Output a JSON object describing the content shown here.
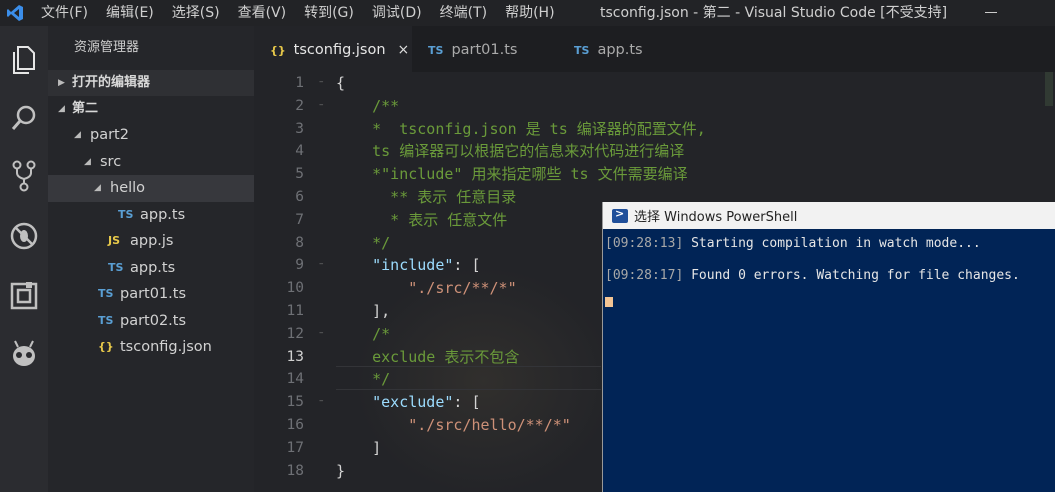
{
  "window": {
    "title": "tsconfig.json - 第二 - Visual Studio Code [不受支持]",
    "menu": [
      "文件(F)",
      "编辑(E)",
      "选择(S)",
      "查看(V)",
      "转到(G)",
      "调试(D)",
      "终端(T)",
      "帮助(H)"
    ]
  },
  "activity_bar": [
    "explorer-icon",
    "search-icon",
    "source-control-icon",
    "debug-icon",
    "extensions-icon",
    "alien-icon"
  ],
  "sidebar": {
    "header": "资源管理器",
    "open_editors": "打开的编辑器",
    "workspace": "第二",
    "tree": [
      {
        "label": "part2",
        "type": "folder",
        "depth": 1
      },
      {
        "label": "src",
        "type": "folder",
        "depth": 2
      },
      {
        "label": "hello",
        "type": "folder",
        "depth": 3,
        "selected": true
      },
      {
        "label": "app.ts",
        "type": "ts",
        "icon": "TS",
        "depth": 4
      },
      {
        "label": "app.js",
        "type": "js",
        "icon": "JS",
        "depth": 3
      },
      {
        "label": "app.ts",
        "type": "ts",
        "icon": "TS",
        "depth": 3
      },
      {
        "label": "part01.ts",
        "type": "ts",
        "icon": "TS",
        "depth": 2
      },
      {
        "label": "part02.ts",
        "type": "ts",
        "icon": "TS",
        "depth": 2
      },
      {
        "label": "tsconfig.json",
        "type": "json",
        "icon": "{}",
        "depth": 2
      }
    ]
  },
  "tabs": [
    {
      "icon": "{}",
      "label": "tsconfig.json",
      "active": true,
      "close": "×"
    },
    {
      "icon": "TS",
      "label": "part01.ts",
      "active": false
    },
    {
      "icon": "TS",
      "label": "app.ts",
      "active": false
    }
  ],
  "editor": {
    "current_line": 13,
    "line_numbers": [
      "1",
      "2",
      "3",
      "4",
      "5",
      "6",
      "7",
      "8",
      "9",
      "10",
      "11",
      "12",
      "13",
      "14",
      "15",
      "16",
      "17",
      "18"
    ],
    "lines": [
      [
        {
          "t": "{",
          "c": "pun"
        }
      ],
      [
        {
          "t": "    /**",
          "c": "com"
        }
      ],
      [
        {
          "t": "    *  tsconfig.json 是 ts 编译器的配置文件,",
          "c": "com"
        }
      ],
      [
        {
          "t": "    ts 编译器可以根据它的信息来对代码进行编译",
          "c": "com"
        }
      ],
      [
        {
          "t": "    *\"include\" 用来指定哪些 ts 文件需要编译",
          "c": "com"
        }
      ],
      [
        {
          "t": "      ** 表示 任意目录",
          "c": "com"
        }
      ],
      [
        {
          "t": "      * 表示 任意文件",
          "c": "com"
        }
      ],
      [
        {
          "t": "    */",
          "c": "com"
        }
      ],
      [
        {
          "t": "    ",
          "c": "pun"
        },
        {
          "t": "\"include\"",
          "c": "key"
        },
        {
          "t": ": [",
          "c": "pun"
        }
      ],
      [
        {
          "t": "        ",
          "c": "pun"
        },
        {
          "t": "\"./src/**/*\"",
          "c": "str"
        }
      ],
      [
        {
          "t": "    ],",
          "c": "pun"
        }
      ],
      [
        {
          "t": "    /*",
          "c": "com"
        }
      ],
      [
        {
          "t": "    exclude 表示不包含",
          "c": "com"
        }
      ],
      [
        {
          "t": "    */",
          "c": "com"
        }
      ],
      [
        {
          "t": "    ",
          "c": "pun"
        },
        {
          "t": "\"exclude\"",
          "c": "key"
        },
        {
          "t": ": [",
          "c": "pun"
        }
      ],
      [
        {
          "t": "        ",
          "c": "pun"
        },
        {
          "t": "\"./src/hello/**/*\"",
          "c": "str"
        }
      ],
      [
        {
          "t": "    ]",
          "c": "pun"
        }
      ],
      [
        {
          "t": "}",
          "c": "pun"
        }
      ]
    ]
  },
  "powershell": {
    "title": "选择 Windows PowerShell",
    "lines": [
      {
        "time": "[09:28:13]",
        "text": " Starting compilation in watch mode..."
      },
      {
        "time": "[09:28:17]",
        "text": " Found 0 errors. Watching for file changes."
      }
    ]
  }
}
